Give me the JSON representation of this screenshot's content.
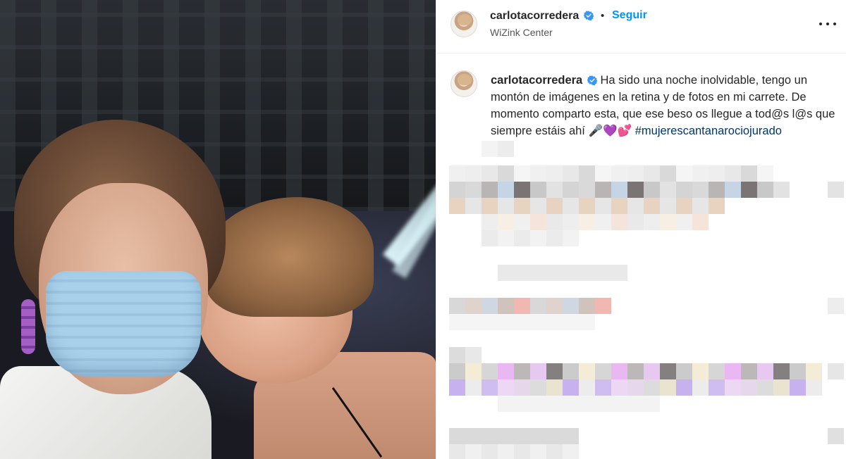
{
  "post": {
    "username": "carlotacorredera",
    "follow_label": "Seguir",
    "location": "WiZink Center",
    "caption_text": "Ha sido una noche inolvidable, tengo un montón de imágenes en la retina y de fotos en mi carrete. De momento comparto esta, que ese beso os llegue a tod@s l@s que siempre estáis ahí 🎤💜💕",
    "hashtag": "#mujerescantanarociojurado"
  },
  "colors": {
    "accent_blue": "#0095f6",
    "hashtag": "#00376b",
    "verified": "#3897f0"
  },
  "icons": [
    "verified-badge-icon",
    "more-options-icon"
  ]
}
